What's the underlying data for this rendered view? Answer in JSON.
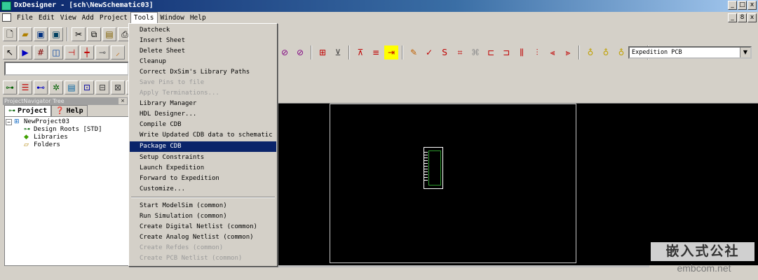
{
  "window": {
    "title": "DxDesigner - [sch\\NewSchematic03]",
    "buttons": [
      "_",
      "□",
      "x"
    ]
  },
  "menubar": {
    "items": [
      "File",
      "Edit",
      "View",
      "Add",
      "Project",
      "Tools",
      "Window",
      "Help"
    ],
    "active": "Tools",
    "doc_buttons": [
      "_",
      "8",
      "x"
    ]
  },
  "toolbar": {
    "combo_value": "Expedition PCB"
  },
  "navigator": {
    "title": "ProjectNavigator Tree",
    "tabs": [
      "Project",
      "Help"
    ],
    "tree": {
      "root": "NewProject03",
      "expander": "−",
      "children": [
        "Design Roots [STD]",
        "Libraries",
        "Folders"
      ]
    }
  },
  "tools_menu": {
    "items": [
      {
        "label": "Datcheck",
        "disabled": false
      },
      {
        "label": "Insert Sheet",
        "disabled": false
      },
      {
        "label": "Delete Sheet",
        "disabled": false
      },
      {
        "label": "Cleanup",
        "disabled": false
      },
      {
        "label": "Correct DxSim's Library Paths",
        "disabled": false
      },
      {
        "label": "Save Pins to file",
        "disabled": true
      },
      {
        "label": "Apply Terminations...",
        "disabled": true
      },
      {
        "label": "Library Manager",
        "disabled": false
      },
      {
        "label": "HDL Designer...",
        "disabled": false
      },
      {
        "label": "Compile CDB",
        "disabled": false
      },
      {
        "label": "Write Updated CDB data to schematic",
        "disabled": false
      },
      {
        "label": "Package CDB",
        "disabled": false,
        "highlighted": true
      },
      {
        "label": "Setup Constraints",
        "disabled": false
      },
      {
        "label": "Launch Expedition",
        "disabled": false
      },
      {
        "label": "Forward to Expedition",
        "disabled": false
      },
      {
        "label": "Customize...",
        "disabled": false
      },
      {
        "label": "Start ModelSim (common)",
        "disabled": false
      },
      {
        "label": "Run Simulation (common)",
        "disabled": false
      },
      {
        "label": "Create Digital Netlist (common)",
        "disabled": false
      },
      {
        "label": "Create Analog Netlist (common)",
        "disabled": false
      },
      {
        "label": "Create Refdes (common)",
        "disabled": true
      },
      {
        "label": "Create PCB Netlist (common)",
        "disabled": true
      }
    ]
  },
  "watermark": {
    "cn": "嵌入式公社",
    "en": "embcom.net"
  },
  "colors": {
    "workspace": "#000000",
    "menu_highlight": "#0a246a",
    "part_inner": "#2c9a2c"
  }
}
